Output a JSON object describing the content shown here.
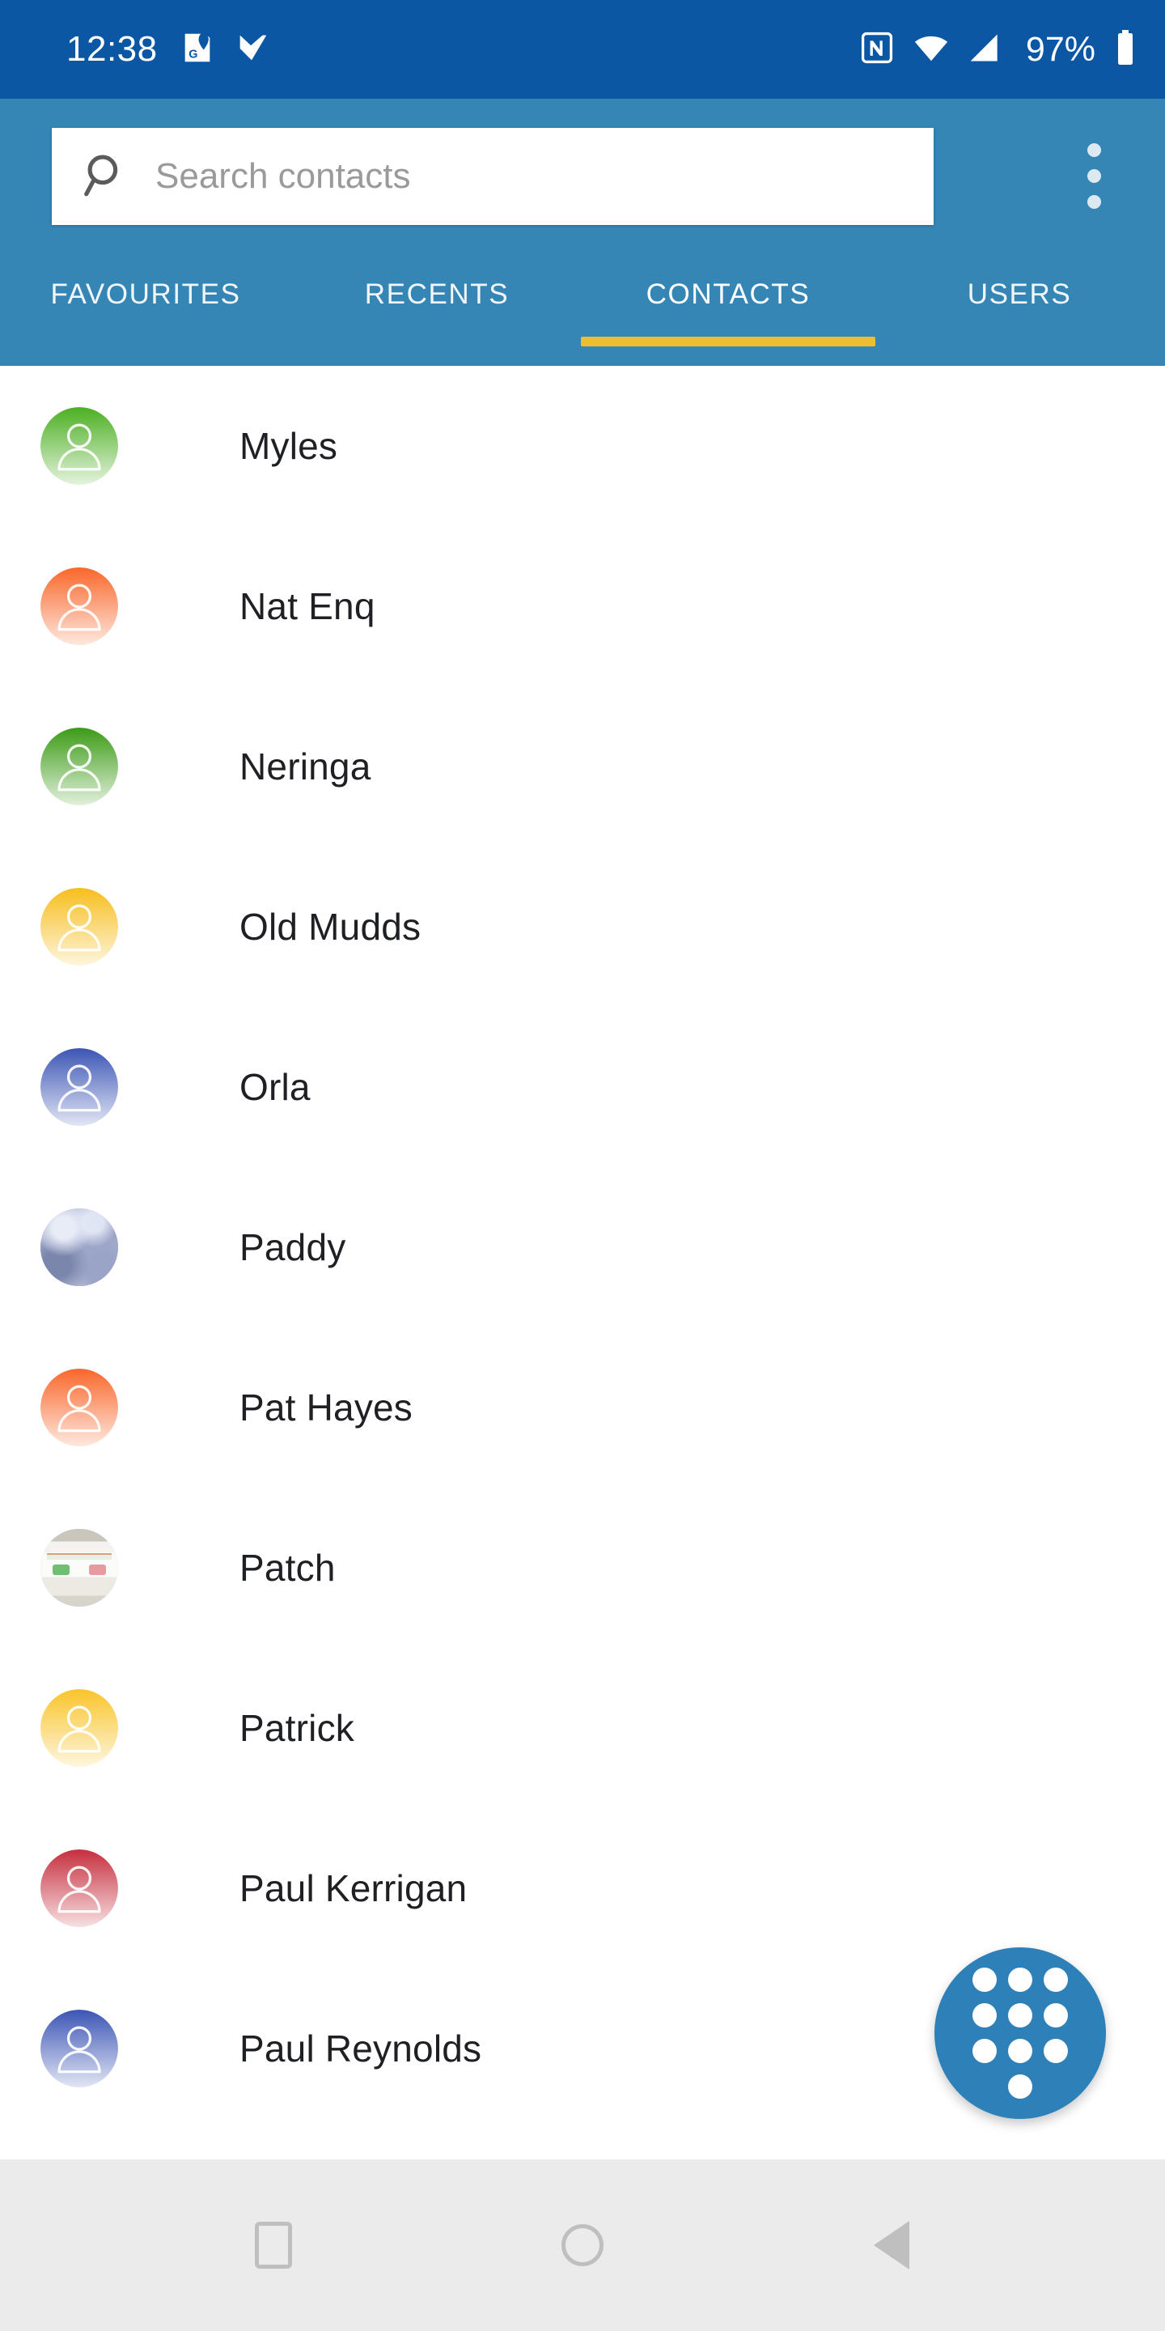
{
  "status_bar": {
    "time": "12:38",
    "battery_percent": "97%",
    "left_icons": [
      "google-maps-icon",
      "tick-checkmark-icon"
    ],
    "right_icons": [
      "nfc-icon",
      "wifi-icon",
      "cellular-signal-icon",
      "battery-icon"
    ],
    "background_color": "#0B57A4"
  },
  "header": {
    "background_color": "#3585B5",
    "search": {
      "placeholder": "Search contacts",
      "value": "",
      "icon": "search-icon"
    },
    "overflow_menu": "overflow-menu-icon"
  },
  "tabs": {
    "active_index": 2,
    "indicator_color": "#EDBE32",
    "items": [
      {
        "label": "FAVOURITES"
      },
      {
        "label": "RECENTS"
      },
      {
        "label": "CONTACTS"
      },
      {
        "label": "USERS"
      }
    ]
  },
  "contacts": [
    {
      "name": "Myles",
      "avatar_type": "initial-placeholder",
      "avatar_color": "#4CAF22"
    },
    {
      "name": "Nat Enq",
      "avatar_type": "initial-placeholder",
      "avatar_color": "#F9672B"
    },
    {
      "name": "Neringa",
      "avatar_type": "initial-placeholder",
      "avatar_color": "#3C9B16"
    },
    {
      "name": "Old Mudds",
      "avatar_type": "initial-placeholder",
      "avatar_color": "#F7BE1E"
    },
    {
      "name": "Orla",
      "avatar_type": "initial-placeholder",
      "avatar_color": "#3C55B5"
    },
    {
      "name": "Paddy",
      "avatar_type": "photo",
      "avatar_color": "#8E9CC4"
    },
    {
      "name": "Pat Hayes",
      "avatar_type": "initial-placeholder",
      "avatar_color": "#F9672B"
    },
    {
      "name": "Patch",
      "avatar_type": "photo",
      "avatar_color": "#D8D6CC"
    },
    {
      "name": "Patrick",
      "avatar_type": "initial-placeholder",
      "avatar_color": "#F9C42B"
    },
    {
      "name": "Paul Kerrigan",
      "avatar_type": "initial-placeholder",
      "avatar_color": "#C62F3E"
    },
    {
      "name": "Paul Reynolds",
      "avatar_type": "initial-placeholder",
      "avatar_color": "#3C55B5"
    }
  ],
  "fab": {
    "icon": "dialpad-icon",
    "color": "#2E81B8"
  },
  "navigation_bar": {
    "background_color": "#EBEBEB",
    "buttons": [
      {
        "name": "recents-button"
      },
      {
        "name": "home-button"
      },
      {
        "name": "back-button"
      }
    ]
  }
}
